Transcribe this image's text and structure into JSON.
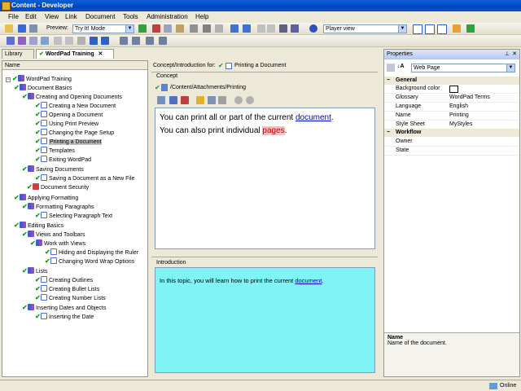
{
  "window": {
    "title": "Content - Developer"
  },
  "menu": [
    "File",
    "Edit",
    "View",
    "Link",
    "Document",
    "Tools",
    "Administration",
    "Help"
  ],
  "toolbar": {
    "preview_label": "Preview:",
    "preview_mode": "Try It! Mode",
    "view_select": "Player view"
  },
  "tabs": [
    {
      "label": "Library"
    },
    {
      "label": "WordPad Training"
    }
  ],
  "tree": {
    "header": "Name",
    "nodes": [
      "WordPad Training",
      "Document Basics",
      "Creating and Opening Documents",
      "Creating a New Document",
      "Opening a Document",
      "Using Print Preview",
      "Changing the Page Setup",
      "Printing a Document",
      "Templates",
      "Exiting WordPad",
      "Saving Documents",
      "Saving a Document as a New File",
      "Document Security",
      "Applying Formatting",
      "Formatting Paragraphs",
      "Selecting Paragraph Text",
      "Editing Basics",
      "Views and Toolbars",
      "Work with Views",
      "Hiding and Displaying the Ruler",
      "Changing Word Wrap Options",
      "Lists",
      "Creating Outlines",
      "Creating Bullet Lists",
      "Creating Number Lists",
      "Inserting Dates and Objects",
      "Inserting the Date"
    ]
  },
  "concept": {
    "for_label": "Concept/Introduction for:",
    "for_doc": "Printing a Document",
    "section": "Concept",
    "path": "/Content/Attachments/Printing",
    "line1_pre": "You can print all or part of the current ",
    "line1_link": "document",
    "line1_post": ".",
    "line2_pre": "You can also print individual ",
    "line2_link": "pages",
    "line2_post": "."
  },
  "intro": {
    "section": "Introduction",
    "text_pre": "In this topic, you will learn how to print the current ",
    "text_link": "document",
    "text_post": "."
  },
  "properties": {
    "title": "Properties",
    "type_select": "Web Page",
    "categories": [
      {
        "name": "General",
        "rows": [
          {
            "key": "Background color",
            "value": ""
          },
          {
            "key": "Glossary",
            "value": "WordPad Terms"
          },
          {
            "key": "Language",
            "value": "English"
          },
          {
            "key": "Name",
            "value": "Printing"
          },
          {
            "key": "Style Sheet",
            "value": "MyStyles"
          }
        ]
      },
      {
        "name": "Workflow",
        "rows": [
          {
            "key": "Owner",
            "value": ""
          },
          {
            "key": "State",
            "value": ""
          }
        ]
      }
    ],
    "desc_title": "Name",
    "desc_text": "Name of the document."
  },
  "status": {
    "online": "Online"
  },
  "colors": {
    "titlebar": "#0a5fd8",
    "intro_bg": "#80f4f4",
    "link": "#0000cc"
  }
}
